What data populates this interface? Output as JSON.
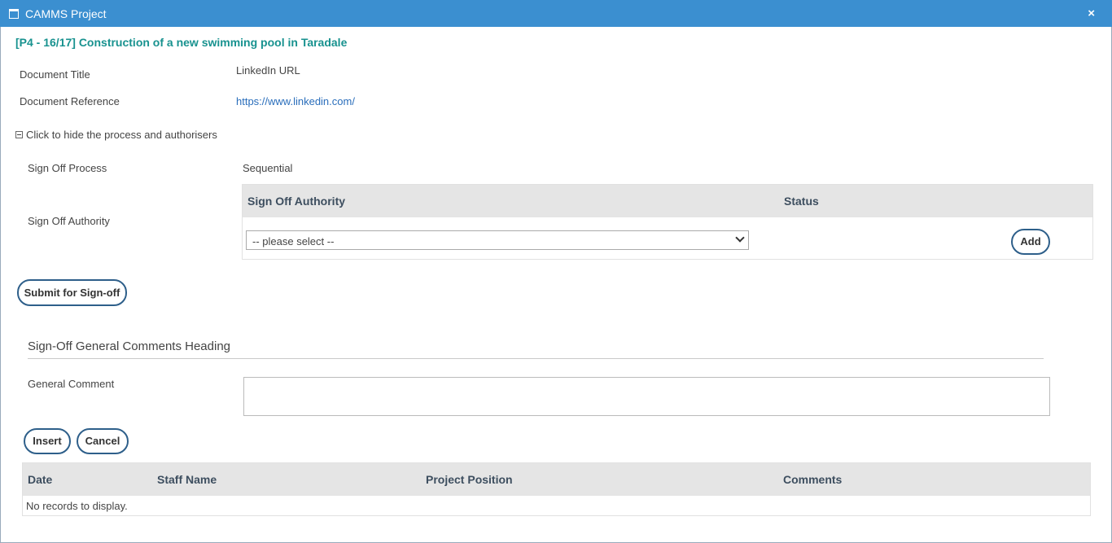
{
  "window": {
    "title": "CAMMS Project",
    "close_glyph": "×"
  },
  "project_title": "[P4 - 16/17] Construction of a new swimming pool in Taradale",
  "document": {
    "title_label": "Document Title",
    "title_value": "LinkedIn URL",
    "reference_label": "Document Reference",
    "reference_value": "https://www.linkedin.com/"
  },
  "toggle_text": "Click to hide the process and authorisers",
  "sign_off": {
    "process_label": "Sign Off Process",
    "process_value": "Sequential",
    "authority_label": "Sign Off Authority",
    "table_headers": [
      "Sign Off Authority",
      "Status"
    ],
    "select_value": "-- please select --",
    "add_label": "Add"
  },
  "submit_label": "Submit for Sign-off",
  "comments": {
    "heading": "Sign-Off General Comments Heading",
    "general_comment_label": "General Comment",
    "insert_label": "Insert",
    "cancel_label": "Cancel",
    "table_headers": [
      "Date",
      "Staff Name",
      "Project Position",
      "Comments"
    ],
    "empty_text": "No records to display."
  },
  "colors": {
    "titlebar": "#3b8fd0",
    "project_title": "#18928f",
    "link": "#2a6ebb",
    "button_border": "#2e5f8a",
    "grid_header": "#e5e5e5"
  },
  "icons": [
    "window-icon",
    "close-icon",
    "collapse-icon",
    "chevron-down-icon"
  ]
}
